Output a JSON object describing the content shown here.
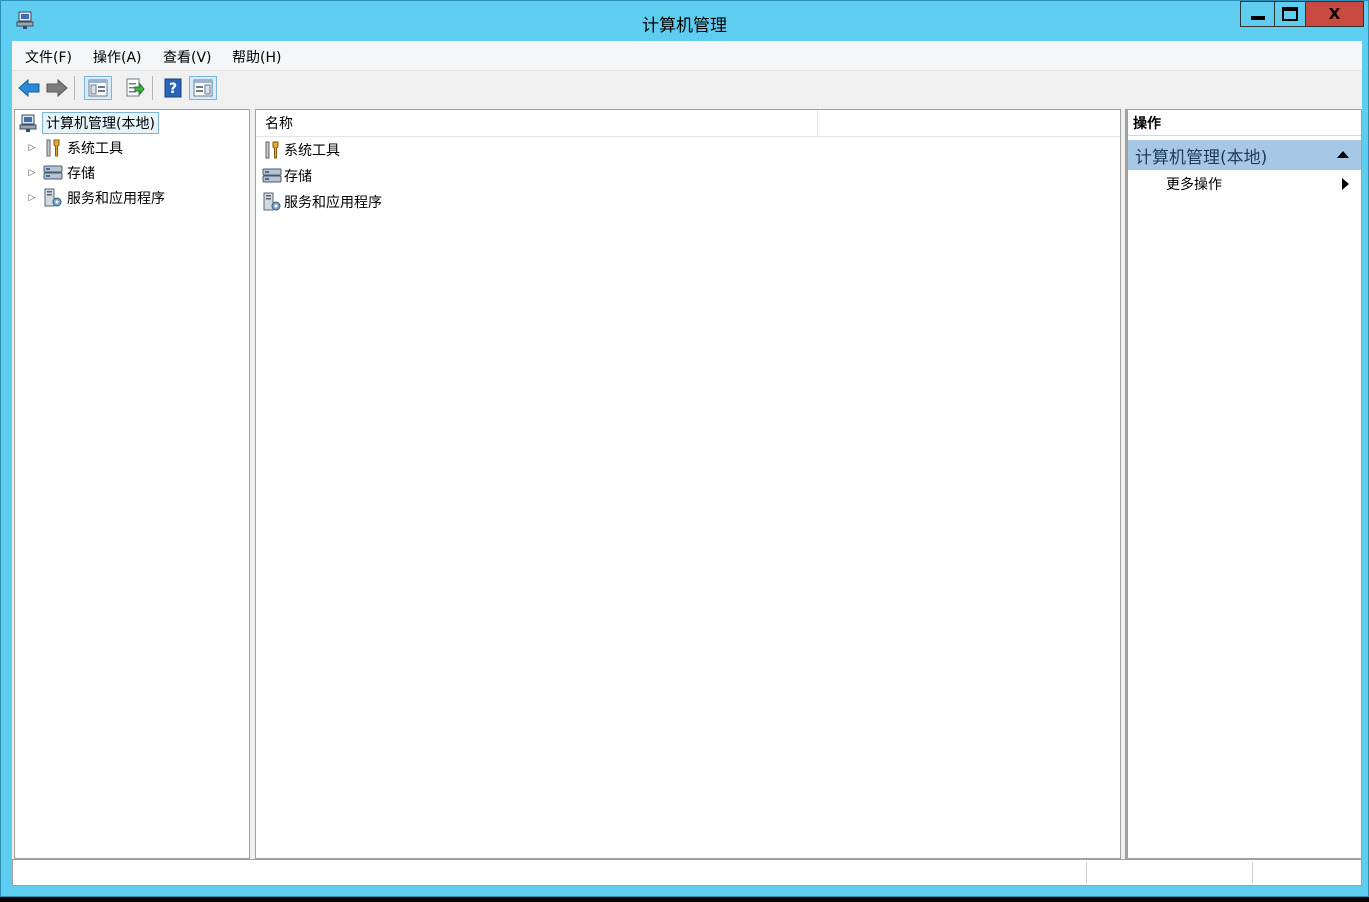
{
  "window": {
    "title": "计算机管理"
  },
  "controls": {
    "close_label": "X"
  },
  "menubar": {
    "items": [
      {
        "label": "文件(F)"
      },
      {
        "label": "操作(A)"
      },
      {
        "label": "查看(V)"
      },
      {
        "label": "帮助(H)"
      }
    ]
  },
  "toolbar": {
    "icons": [
      "back-arrow-icon",
      "forward-arrow-icon",
      "show-hide-console-tree-icon",
      "export-list-icon",
      "help-icon",
      "show-hide-action-pane-icon"
    ]
  },
  "tree": {
    "root": {
      "label": "计算机管理(本地)",
      "icon": "computer-management-icon"
    },
    "children": [
      {
        "label": "系统工具",
        "icon": "system-tools-icon"
      },
      {
        "label": "存储",
        "icon": "storage-icon"
      },
      {
        "label": "服务和应用程序",
        "icon": "services-applications-icon"
      }
    ]
  },
  "list": {
    "column_header": "名称",
    "items": [
      {
        "label": "系统工具",
        "icon": "system-tools-icon"
      },
      {
        "label": "存储",
        "icon": "storage-icon"
      },
      {
        "label": "服务和应用程序",
        "icon": "services-applications-icon"
      }
    ]
  },
  "actions": {
    "header": "操作",
    "group_title": "计算机管理(本地)",
    "items": [
      {
        "label": "更多操作"
      }
    ]
  },
  "colors": {
    "titlebar": "#5fcdf0",
    "close_button": "#c7493f",
    "action_group_bg": "#a6c8e4",
    "selection_bg": "#e5f3fb"
  }
}
